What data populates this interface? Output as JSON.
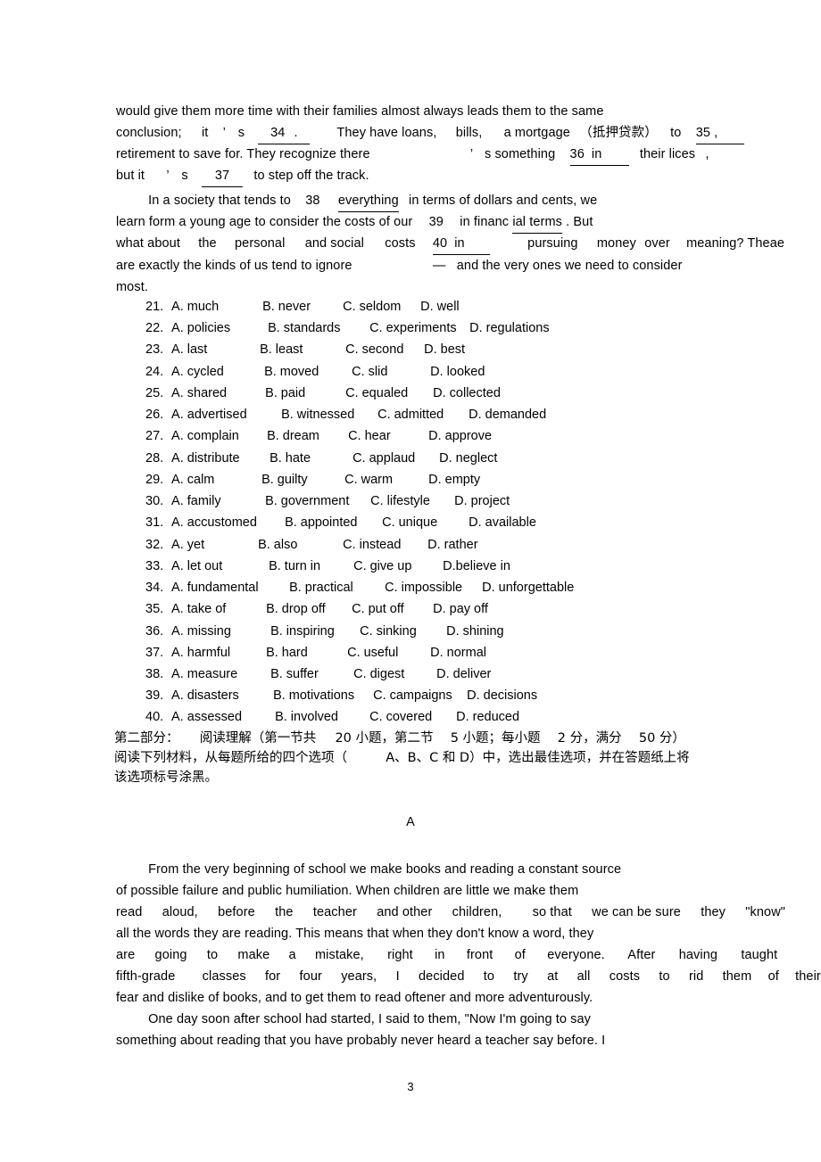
{
  "document": {
    "page_number": "3",
    "section_label": "A"
  },
  "cloze_passage": {
    "line1": "would give them more time with their families almost always leads them to the same",
    "line2": {
      "a": "conclusion;",
      "b": "it",
      "apos": "’",
      "c": "s",
      "blank34": "34",
      "period": ".",
      "d": "They have loans,",
      "e": "bills,",
      "f": "a mortgage",
      "cn": "（抵押贷款）",
      "g": "to",
      "blank35": "35",
      "comma": ","
    },
    "line3": {
      "a": "retirement to save for. They recognize there",
      "apos": "’",
      "b": "s something",
      "blank36": "36",
      "c": "in",
      "d": "their lices",
      "comma": ","
    },
    "line4": {
      "a": "but it",
      "apos": "’",
      "b": "s",
      "blank37": "37",
      "c": "to step off the track."
    },
    "line5": {
      "a": "In a society that tends to",
      "blank38": "38",
      "b": "everything",
      "c": "in terms of dollars and cents, we"
    },
    "line6": {
      "a": "learn form a young age to consider the costs of our",
      "blank39": "39",
      "b": "in financ",
      "c": "ial terms",
      "d": ". But"
    },
    "line7": {
      "a": "what about",
      "b": "the",
      "c": "personal",
      "d": "and social",
      "e": "costs",
      "blank40": "40",
      "f": "in",
      "g": "pursuing",
      "h": "money",
      "i": "over",
      "j": "meaning? Theae"
    },
    "line8": {
      "a": "are exactly the kinds of us tend to ignore",
      "dash": "—",
      "b": "and the very ones we need to consider"
    },
    "line9": "most."
  },
  "options": [
    {
      "num": "21.",
      "a": "A. much",
      "b": "B. never",
      "c": "C. seldom",
      "d": "D. well"
    },
    {
      "num": "22.",
      "a": "A. policies",
      "b": "B. standards",
      "c": "C. experiments",
      "d": "D. regulations"
    },
    {
      "num": "23.",
      "a": "A. last",
      "b": "B. least",
      "c": "C. second",
      "d": "D. best"
    },
    {
      "num": "24.",
      "a": "A. cycled",
      "b": "B. moved",
      "c": "C. slid",
      "d": "D. looked"
    },
    {
      "num": "25.",
      "a": "A. shared",
      "b": "B. paid",
      "c": "C. equaled",
      "d": "D. collected"
    },
    {
      "num": "26.",
      "a": "A. advertised",
      "b": "B. witnessed",
      "c": "C. admitted",
      "d": "D. demanded"
    },
    {
      "num": "27.",
      "a": "A. complain",
      "b": "B. dream",
      "c": "C. hear",
      "d": "D. approve"
    },
    {
      "num": "28.",
      "a": "A. distribute",
      "b": "B. hate",
      "c": "C. applaud",
      "d": "D. neglect"
    },
    {
      "num": "29.",
      "a": "A. calm",
      "b": "B. guilty",
      "c": "C. warm",
      "d": "D. empty"
    },
    {
      "num": "30.",
      "a": "A. family",
      "b": "B. government",
      "c": "C. lifestyle",
      "d": "D. project"
    },
    {
      "num": "31.",
      "a": "A. accustomed",
      "b": "B. appointed",
      "c": "C. unique",
      "d": "D. available"
    },
    {
      "num": "32.",
      "a": "A. yet",
      "b": "B. also",
      "c": "C. instead",
      "d": "D. rather"
    },
    {
      "num": "33.",
      "a": "A. let out",
      "b": "B. turn in",
      "c": "C. give up",
      "d": "D.believe in"
    },
    {
      "num": "34.",
      "a": "A. fundamental",
      "b": "B. practical",
      "c": "C. impossible",
      "d": "D. unforgettable"
    },
    {
      "num": "35.",
      "a": "A. take of",
      "b": "B. drop off",
      "c": "C. put off",
      "d": "D. pay off"
    },
    {
      "num": "36.",
      "a": "A. missing",
      "b": "B. inspiring",
      "c": "C. sinking",
      "d": "D. shining"
    },
    {
      "num": "37.",
      "a": "A. harmful",
      "b": "B. hard",
      "c": "C. useful",
      "d": "D. normal"
    },
    {
      "num": "38.",
      "a": "A. measure",
      "b": "B. suffer",
      "c": "C. digest",
      "d": "D. deliver"
    },
    {
      "num": "39.",
      "a": "A. disasters",
      "b": "B. motivations",
      "c": "C. campaigns",
      "d": "D. decisions"
    },
    {
      "num": "40.",
      "a": "A. assessed",
      "b": "B. involved",
      "c": "C. covered",
      "d": "D. reduced"
    }
  ],
  "instructions": {
    "line1_a": "第二部分：",
    "line1_b": "阅读理解（第一节共",
    "line1_c": "20 小题，第二节",
    "line1_d": "5 小题；每小题",
    "line1_e": "2 分，满分",
    "line1_f": "50 分）",
    "line2_a": "阅读下列材料，从每题所给的四个选项（",
    "line2_b": "A、B、C 和 D）中，选出最佳选项，并在答题纸上将",
    "line3": "该选项标号涂黑。"
  },
  "reading_passage": {
    "line1": "From the very beginning of school we make books and reading a constant source",
    "line2": "of possible failure and public humiliation. When children are little we make them",
    "line3": {
      "a": "read",
      "b": "aloud,",
      "c": "before",
      "d": "the",
      "e": "teacher",
      "f": "and other",
      "g": "children,",
      "h": "so that",
      "i": "we can be sure",
      "j": "they",
      "k": "\"know\""
    },
    "line4": "all the words they are reading. This means that when they don't know a word, they",
    "line5": {
      "a": "are",
      "b": "going",
      "c": "to",
      "d": "make",
      "e": "a",
      "f": "mistake,",
      "g": "right",
      "h": "in",
      "i": "front",
      "j": "of",
      "k": "everyone.",
      "l": "After",
      "m": "having",
      "n": "taught"
    },
    "line6": {
      "a": "fifth-grade",
      "b": "classes",
      "c": "for",
      "d": "four",
      "e": "years,",
      "f": "I",
      "g": "decided",
      "h": "to",
      "i": "try",
      "j": "at",
      "k": "all",
      "l": "costs",
      "m": "to",
      "n": "rid",
      "o": "them",
      "p": "of",
      "q": "their"
    },
    "line7": "fear and dislike of books, and to get them to read oftener and more adventurously.",
    "line8": "One day soon after school had started, I said to them, \"Now I'm going to say",
    "line9": "something about reading that you have probably never heard a teacher say before. I"
  }
}
